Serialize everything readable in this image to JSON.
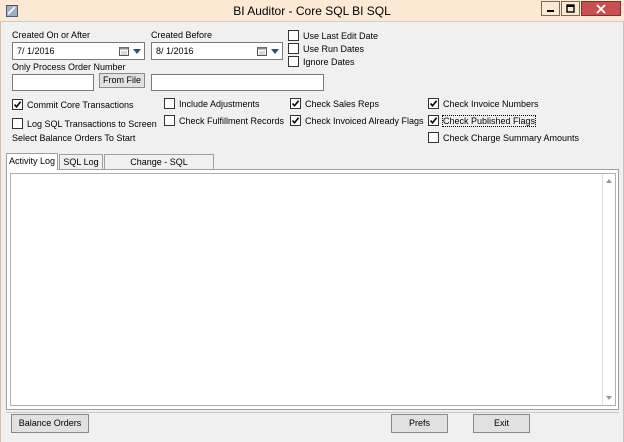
{
  "window": {
    "title": "BI Auditor - Core SQL BI SQL"
  },
  "dates": {
    "created_on_or_after_label": "Created On or After",
    "created_on_or_after_value": "7/  1/2016",
    "created_before_label": "Created  Before",
    "created_before_value": "8/  1/2016"
  },
  "order": {
    "only_process_label": "Only Process Order Number",
    "order_number_value": "",
    "from_file_label": "From File",
    "file_path_value": ""
  },
  "date_options": [
    {
      "label": "Use Last Edit Date",
      "checked": false
    },
    {
      "label": "Use Run Dates",
      "checked": false
    },
    {
      "label": "Ignore Dates",
      "checked": false
    }
  ],
  "options": {
    "commit_core": {
      "label": "Commit Core Transactions",
      "checked": true
    },
    "log_sql": {
      "label": "Log SQL Transactions to Screen",
      "checked": false
    },
    "include_adjustments": {
      "label": "Include Adjustments",
      "checked": false
    },
    "check_fulfillment": {
      "label": "Check Fulfillment Records",
      "checked": false
    },
    "check_sales_reps": {
      "label": "Check Sales Reps",
      "checked": true
    },
    "check_invoiced_already": {
      "label": "Check Invoiced Already Flags",
      "checked": true
    },
    "check_invoice_numbers": {
      "label": "Check Invoice Numbers",
      "checked": true
    },
    "check_published": {
      "label": "Check Published Flags",
      "checked": true
    },
    "check_charge_summary": {
      "label": "Check Charge Summary Amounts",
      "checked": false
    }
  },
  "status_text": "Select Balance Orders To Start",
  "tabs": [
    {
      "label": "Activity Log",
      "active": true
    },
    {
      "label": "SQL Log",
      "active": false
    },
    {
      "label": "Change - SQL Transactions",
      "active": false
    }
  ],
  "buttons": {
    "balance_orders": "Balance Orders",
    "prefs": "Prefs",
    "exit": "Exit"
  },
  "icons": {
    "app": "app-icon",
    "calendar": "calendar-icon",
    "dropdown": "chevron-down-icon",
    "minimize": "minimize-icon",
    "maximize": "maximize-icon",
    "close": "close-icon"
  },
  "colors": {
    "titlebar": "#fbe9d4",
    "close": "#c75050",
    "client": "#f0f0f0"
  }
}
